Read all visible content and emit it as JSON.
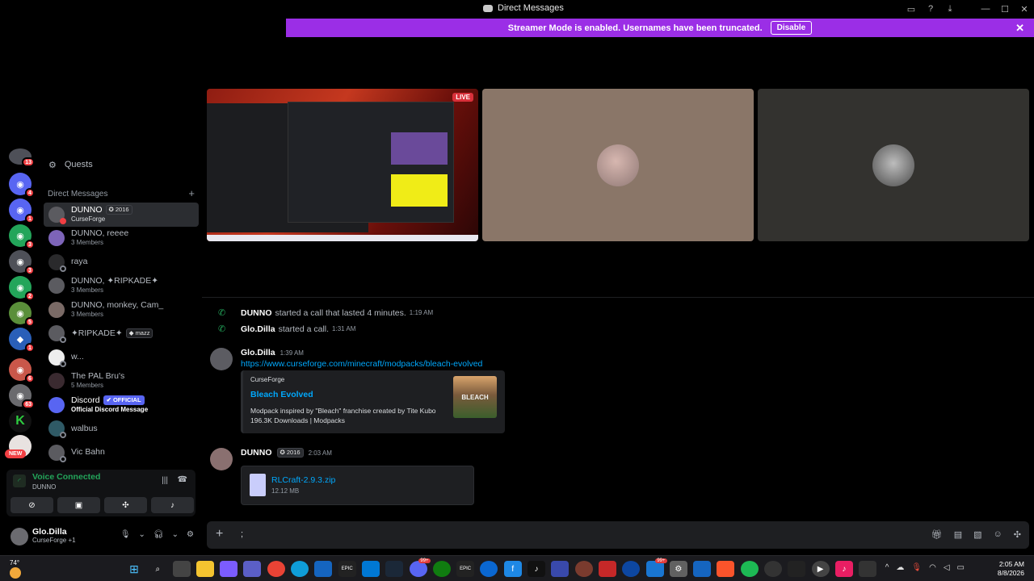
{
  "window": {
    "title": "Direct Messages",
    "controls": [
      "inbox-icon",
      "help-icon",
      "download-icon",
      "minimize-icon",
      "maximize-icon",
      "close-icon"
    ]
  },
  "banner": {
    "text": "Streamer Mode is enabled. Usernames have been truncated.",
    "button": "Disable",
    "color": "#9b2ee6"
  },
  "call": {
    "live_label": "LIVE"
  },
  "guilds": {
    "badges": [
      "13",
      "4",
      "1",
      "3",
      "3",
      "2",
      "5",
      "1",
      "6",
      "63"
    ],
    "new_label": "NEW"
  },
  "sidebar": {
    "quests_label": "Quests",
    "dm_header": "Direct Messages",
    "dms": [
      {
        "name": "DUNNO",
        "tag": "2016",
        "sub": "CurseForge",
        "active": true
      },
      {
        "name": "DUNNO, reeee",
        "sub": "3 Members"
      },
      {
        "name": "raya",
        "sub": ""
      },
      {
        "name": "DUNNO, ✦RIPKADE✦",
        "sub": "3 Members"
      },
      {
        "name": "DUNNO, monkey, Cam_",
        "sub": "3 Members"
      },
      {
        "name": "✦RIPKADE✦",
        "tag": "mazz",
        "sub": ""
      },
      {
        "name": "w...",
        "sub": ""
      },
      {
        "name": "The PAL Bru's",
        "sub": "5 Members"
      },
      {
        "name": "Discord",
        "tag": "OFFICIAL",
        "sub": "Official Discord Message"
      },
      {
        "name": "walbus",
        "sub": ""
      },
      {
        "name": "Vic Bahn",
        "sub": ""
      }
    ]
  },
  "voice": {
    "status": "Voice Connected",
    "channel": "DUNNO"
  },
  "user": {
    "name": "Glo.Dilla",
    "status": "CurseForge +1"
  },
  "chat": {
    "system": [
      {
        "author": "DUNNO",
        "text": "started a call that lasted 4 minutes.",
        "time": "1:19 AM"
      },
      {
        "author": "Glo.Dilla",
        "text": "started a call.",
        "time": "1:31 AM"
      }
    ],
    "messages": [
      {
        "author": "Glo.Dilla",
        "time": "1:39 AM",
        "link": "https://www.curseforge.com/minecraft/modpacks/bleach-evolved",
        "embed": {
          "provider": "CurseForge",
          "title": "Bleach Evolved",
          "description": "Modpack inspired by \"Bleach\" franchise created by Tite Kubo",
          "stats": "196.3K Downloads | Modpacks",
          "thumb_text": "BLEACH"
        }
      },
      {
        "author": "DUNNO",
        "tag": "2016",
        "time": "2:03 AM",
        "file": {
          "name": "RLCraft-2.9.3.zip",
          "size": "12.12 MB"
        }
      }
    ]
  },
  "composer": {
    "value": ";"
  },
  "taskbar": {
    "weather": "74°",
    "time": "2:05 AM",
    "date": "8/8/2026",
    "badges": {
      "discord": "99+",
      "mail": "99+"
    }
  }
}
